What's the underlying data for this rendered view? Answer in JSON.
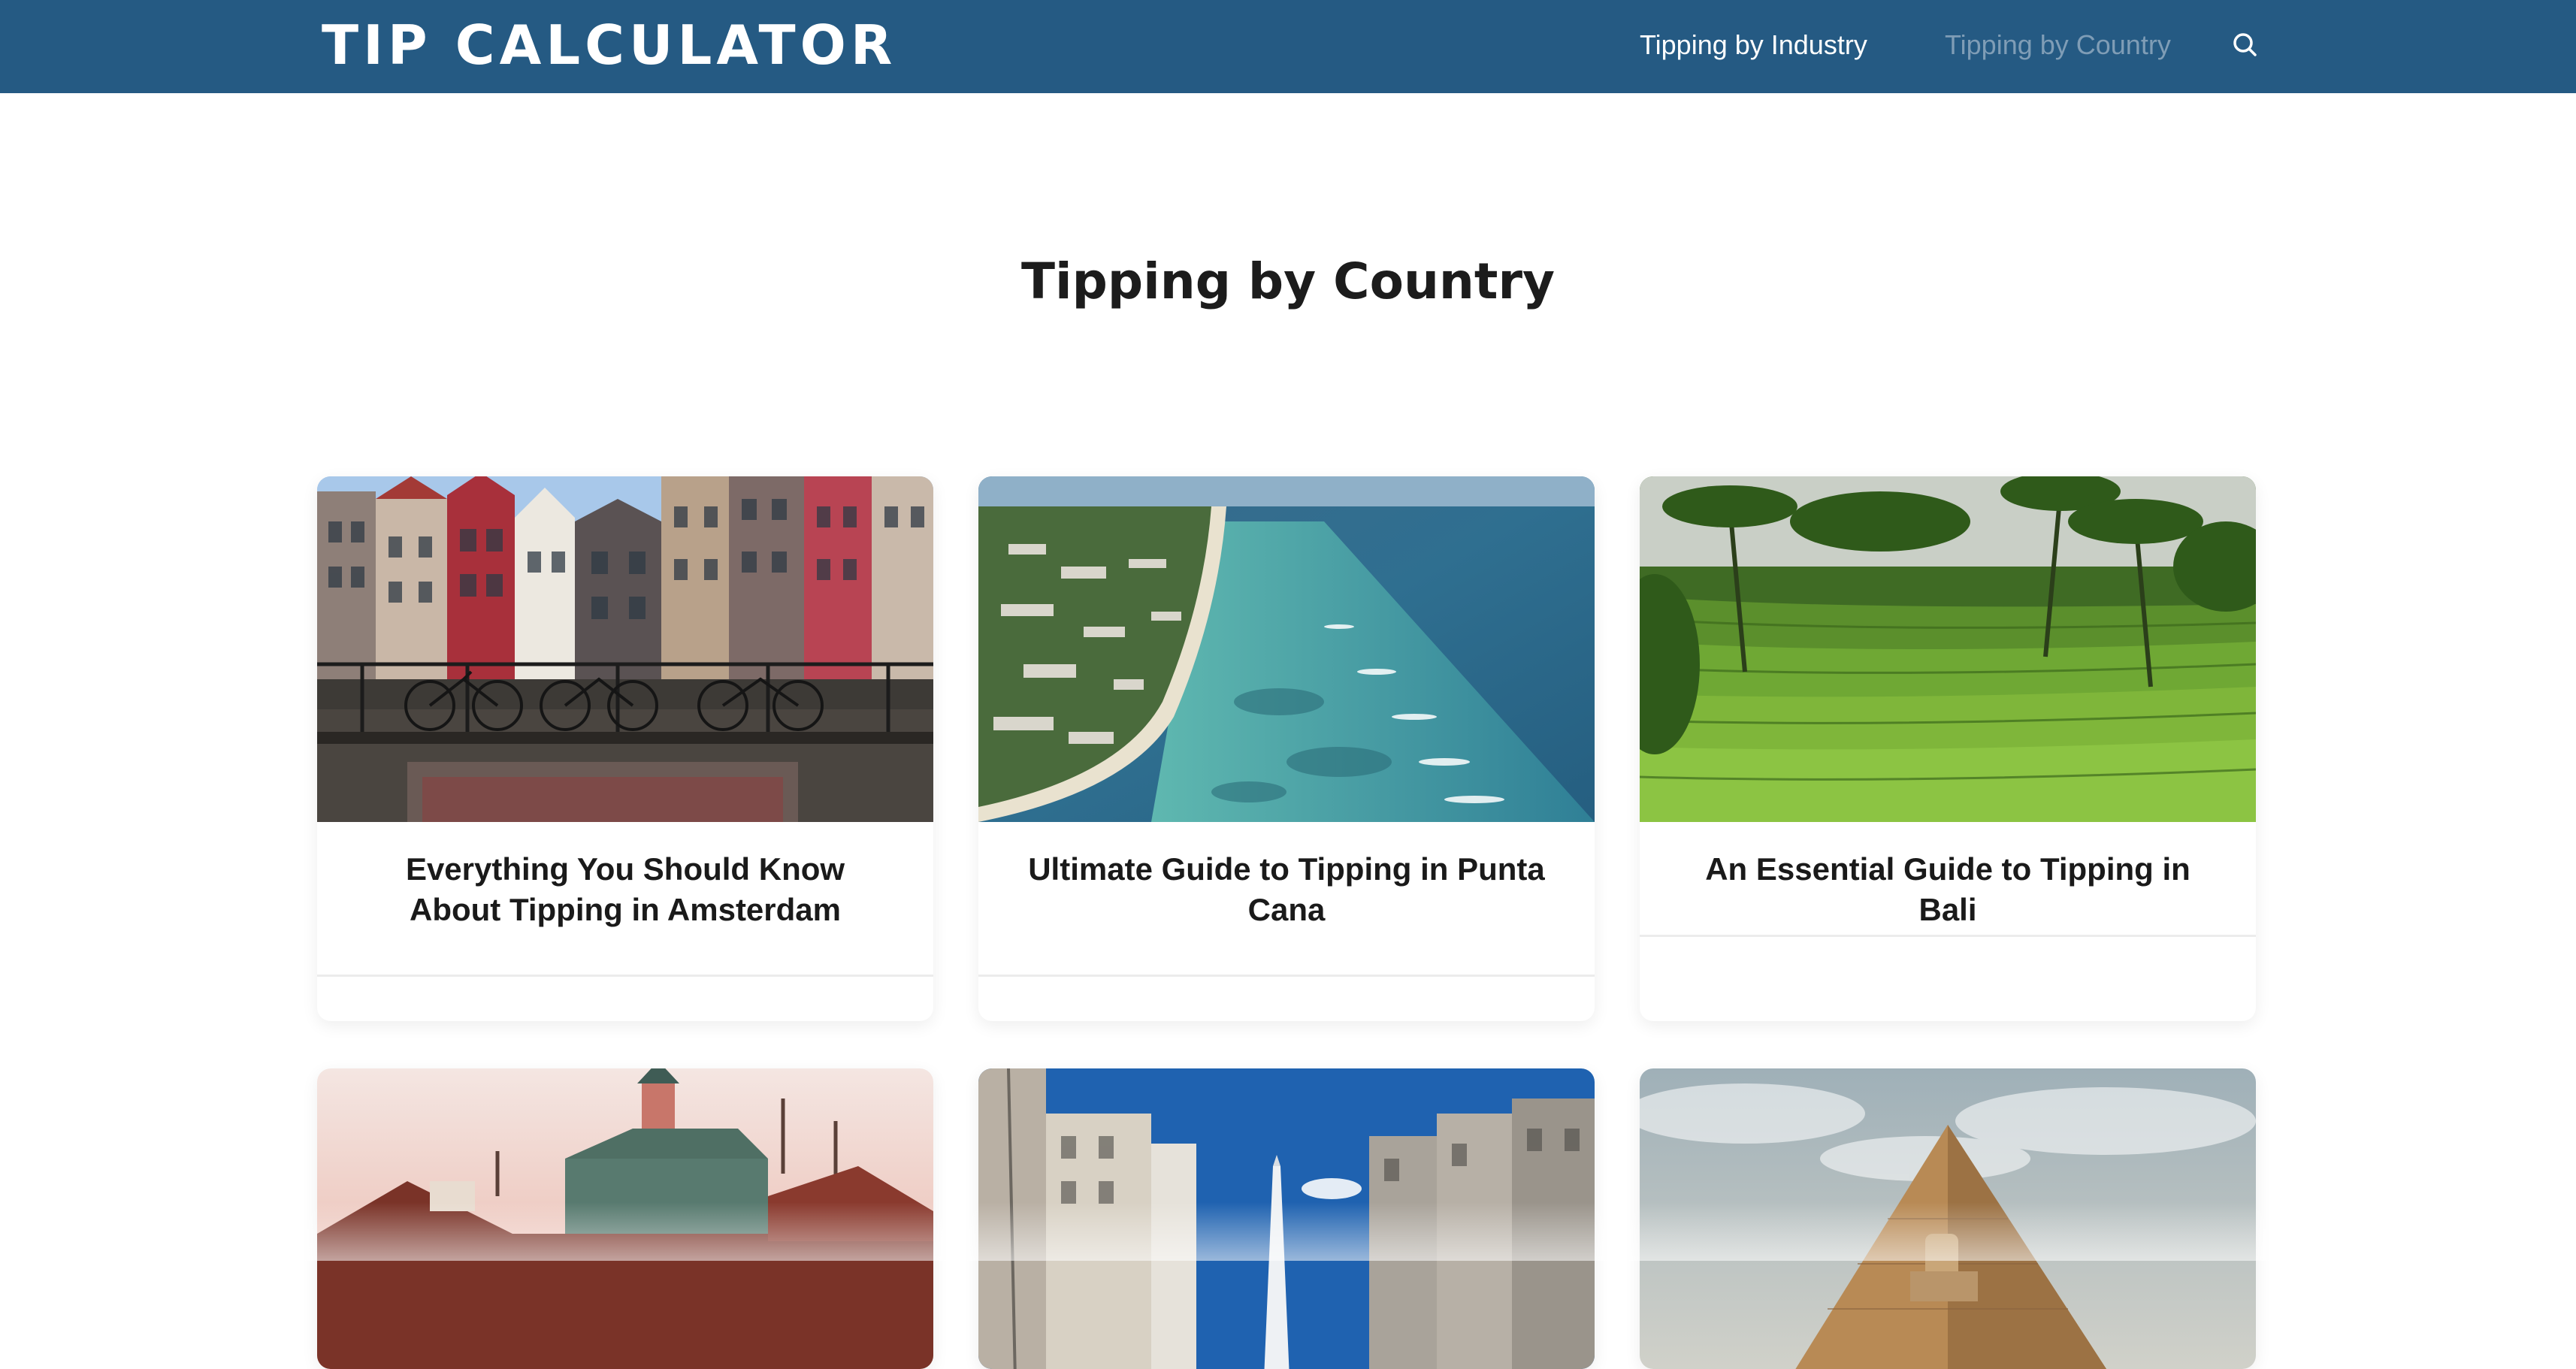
{
  "header": {
    "logo": "TIP CALCULATOR",
    "nav": [
      {
        "label": "Tipping by Industry"
      },
      {
        "label": "Tipping by Country"
      }
    ],
    "search_icon": "search-icon"
  },
  "page": {
    "title": "Tipping by Country"
  },
  "cards": [
    {
      "title": "Everything You Should Know About Tipping in Amsterdam",
      "image": "amsterdam-canal-houses"
    },
    {
      "title": "Ultimate Guide to Tipping in Punta Cana",
      "image": "punta-cana-coast"
    },
    {
      "title": "An Essential Guide to Tipping in Bali",
      "image": "bali-rice-terraces"
    },
    {
      "title": "",
      "image": "old-town-rooftops"
    },
    {
      "title": "",
      "image": "buenos-aires-obelisk"
    },
    {
      "title": "",
      "image": "giza-pyramid"
    }
  ],
  "colors": {
    "header_bg": "#255a83",
    "nav_active": "#7f9db6",
    "text": "#1a1a1a"
  }
}
